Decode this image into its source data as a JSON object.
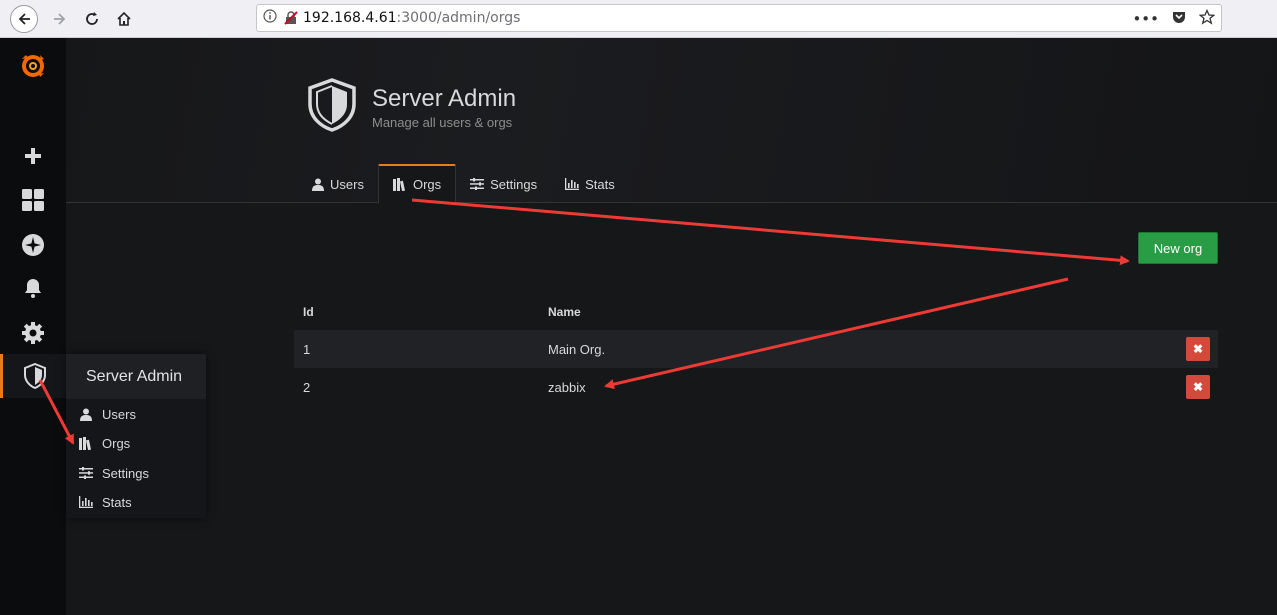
{
  "browser": {
    "url_host": "192.168.4.61",
    "url_path": ":3000/admin/orgs"
  },
  "header": {
    "title": "Server Admin",
    "subtitle": "Manage all users & orgs"
  },
  "tabs": [
    {
      "label": "Users",
      "icon": "user-icon"
    },
    {
      "label": "Orgs",
      "icon": "orgs-icon",
      "active": true
    },
    {
      "label": "Settings",
      "icon": "sliders-icon"
    },
    {
      "label": "Stats",
      "icon": "bar-chart-icon"
    }
  ],
  "actions": {
    "new_org_label": "New org"
  },
  "table": {
    "columns": [
      "Id",
      "Name"
    ],
    "rows": [
      {
        "id": "1",
        "name": "Main Org."
      },
      {
        "id": "2",
        "name": "zabbix"
      }
    ],
    "delete_glyph": "✖"
  },
  "flyout": {
    "title": "Server Admin",
    "items": [
      {
        "label": "Users",
        "icon": "user-icon"
      },
      {
        "label": "Orgs",
        "icon": "orgs-icon"
      },
      {
        "label": "Settings",
        "icon": "sliders-icon"
      },
      {
        "label": "Stats",
        "icon": "bar-chart-icon"
      }
    ]
  },
  "colors": {
    "accent": "#eb7b18",
    "primary_button": "#299c46",
    "danger_button": "#d44a3a",
    "annotation_arrow": "#ee3a35"
  }
}
